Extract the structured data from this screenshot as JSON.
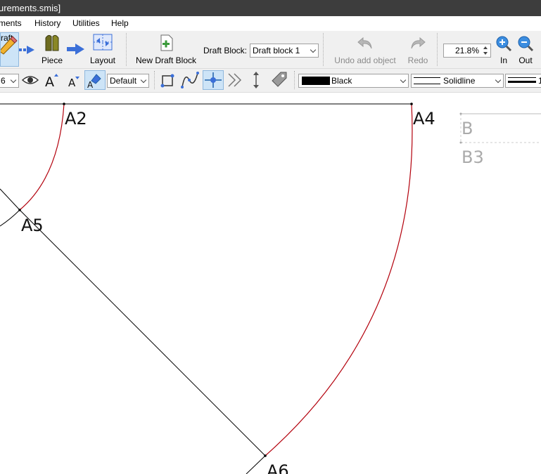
{
  "window": {
    "title": "urements.smis]"
  },
  "menu": {
    "items": [
      "ments",
      "History",
      "Utilities",
      "Help"
    ]
  },
  "toolbar": {
    "draft_label": "raft",
    "piece_label": "Piece",
    "layout_label": "Layout",
    "new_draft_block_label": "New Draft Block",
    "draft_block_label": "Draft Block:",
    "draft_block_value": "Draft block 1",
    "undo_label": "Undo add object",
    "redo_label": "Redo",
    "zoom_value": "21.8%",
    "zoom_in_label": "In",
    "zoom_out_label": "Out"
  },
  "toolbar2": {
    "size_value": "6",
    "font_style_value": "Default",
    "color_value": "Black",
    "line_type_value": "Solidline",
    "line_weight_value": "1"
  },
  "canvas": {
    "points": [
      "A2",
      "A4",
      "A5",
      "A6",
      "B",
      "B3"
    ]
  },
  "colors": {
    "curve": "#b3000c",
    "line": "#000000",
    "accent": "#cde4f7"
  }
}
